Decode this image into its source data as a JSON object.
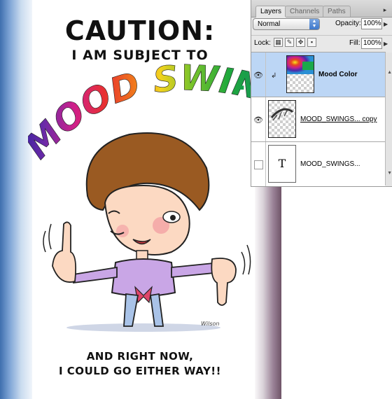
{
  "document": {
    "heading": "CAUTION:",
    "subheading": "I AM SUBJECT TO",
    "mood_text": "MOOD SWINGS",
    "mood_dots": "..",
    "bottom_line1": "AND RIGHT NOW,",
    "bottom_line2": "I COULD GO EITHER WAY!!",
    "artist_signature": "Wilson"
  },
  "layers_panel": {
    "tabs": [
      "Layers",
      "Channels",
      "Paths"
    ],
    "active_tab": "Layers",
    "blend_mode": "Normal",
    "opacity_label": "Opacity:",
    "opacity_value": "100%",
    "lock_label": "Lock:",
    "fill_label": "Fill:",
    "fill_value": "100%",
    "layers": [
      {
        "name": "Mood Color",
        "visible": true,
        "selected": true,
        "clipped": true,
        "thumbnail": "rainbow-gradient"
      },
      {
        "name": "MOOD_SWINGS... copy",
        "visible": true,
        "selected": false,
        "clipped": false,
        "thumbnail": "text-raster"
      },
      {
        "name": "MOOD_SWINGS...",
        "visible": false,
        "selected": false,
        "clipped": false,
        "thumbnail": "type-layer",
        "type_glyph": "T"
      }
    ]
  },
  "colors": {
    "selection_blue": "#bcd6f5",
    "panel_gray": "#e8e8e8",
    "left_border_blue": "#3f6fae",
    "right_border_mauve": "#6f5468"
  }
}
